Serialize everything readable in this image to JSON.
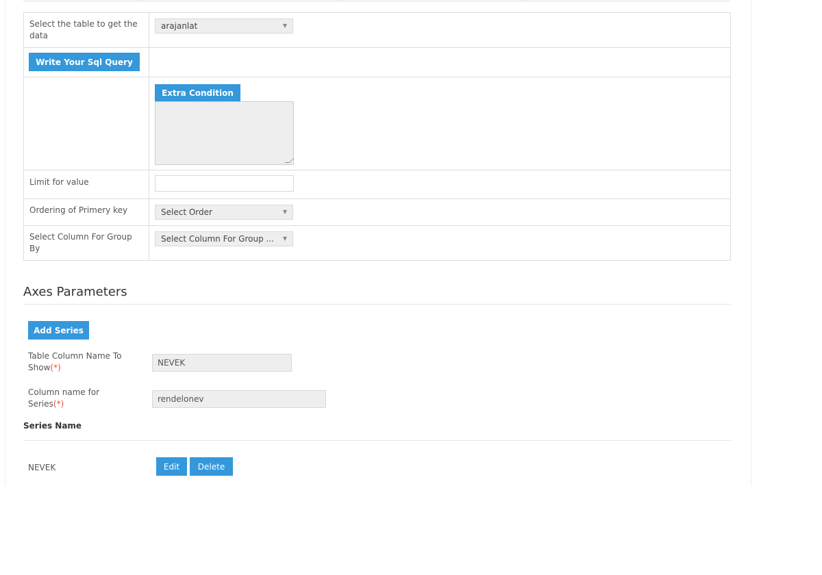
{
  "form": {
    "table_select_label": "Select the table to get the data",
    "table_select_value": "arajanlat",
    "sql_query_button": "Write Your Sql Query",
    "extra_condition_button": "Extra Condition",
    "limit_label": "Limit for value",
    "limit_value": "",
    "ordering_label": "Ordering of Primery key",
    "ordering_value": "Select Order",
    "group_by_label": "Select Column For Group By",
    "group_by_value": "Select Column For Group ..."
  },
  "axes": {
    "title": "Axes Parameters",
    "add_series_button": "Add Series",
    "column_name_label": "Table Column Name To Show",
    "column_name_value": "NEVEK",
    "series_column_label": "Column name for Series",
    "series_column_value": "rendelonev",
    "required_mark": "(*)"
  },
  "series": {
    "header": "Series Name",
    "rows": [
      {
        "name": "NEVEK",
        "edit_label": "Edit",
        "delete_label": "Delete"
      }
    ]
  },
  "colors": {
    "accent": "#3498db",
    "required": "#e74c3c",
    "input_bg": "#eeeeee",
    "border": "#dddddd"
  },
  "icons": {
    "dropdown": "caret-down-icon",
    "resize": "resize-grip-icon"
  }
}
